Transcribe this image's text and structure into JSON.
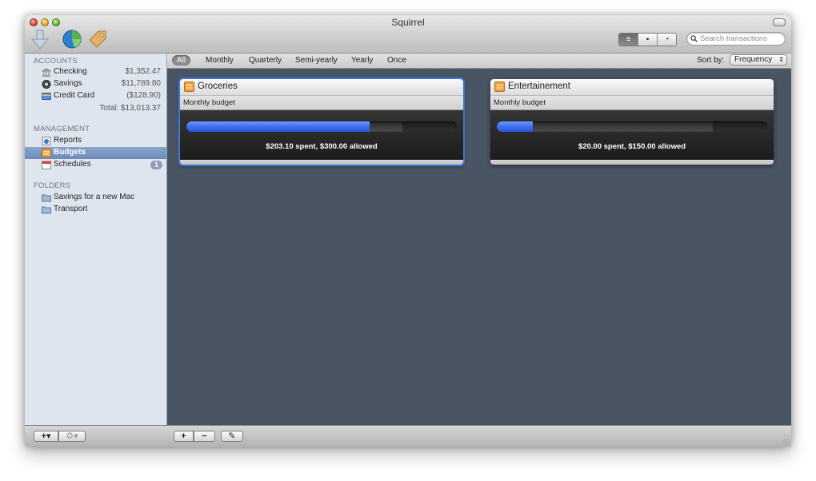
{
  "window": {
    "title": "Squirrel"
  },
  "toolbar": {
    "icons": [
      "download-arrow-icon",
      "globe-chart-icon",
      "tag-icon"
    ],
    "view_modes": [
      {
        "icon": "list-view-icon",
        "glyph": "≡",
        "active": true
      },
      {
        "icon": "column-view-icon",
        "glyph": "▪",
        "active": false
      },
      {
        "icon": "chart-view-icon",
        "glyph": "◔",
        "active": false
      }
    ],
    "search_placeholder": "Search transactions"
  },
  "sidebar": {
    "accounts_header": "ACCOUNTS",
    "accounts": [
      {
        "label": "Checking",
        "amount": "$1,352.47",
        "icon": "bank-icon"
      },
      {
        "label": "Savings",
        "amount": "$11,789.80",
        "icon": "safe-icon"
      },
      {
        "label": "Credit Card",
        "amount": "($128.90)",
        "icon": "credit-card-icon"
      }
    ],
    "total": "Total: $13,013.37",
    "management_header": "MANAGEMENT",
    "management": [
      {
        "label": "Reports",
        "icon": "reports-icon",
        "selected": false
      },
      {
        "label": "Budgets",
        "icon": "budgets-icon",
        "selected": true
      },
      {
        "label": "Schedules",
        "icon": "schedules-icon",
        "selected": false,
        "badge": "1"
      }
    ],
    "folders_header": "FOLDERS",
    "folders": [
      {
        "label": "Savings for a new Mac",
        "icon": "folder-icon"
      },
      {
        "label": "Transport",
        "icon": "folder-icon"
      }
    ]
  },
  "filters": {
    "options": [
      "All",
      "Monthly",
      "Quarterly",
      "Semi-yearly",
      "Yearly",
      "Once"
    ],
    "active": "All",
    "sort_label": "Sort by:",
    "sort_value": "Frequency"
  },
  "budgets": [
    {
      "title": "Groceries",
      "period": "Monthly budget",
      "summary": "$203.10 spent, $300.00 allowed",
      "spent": 203.1,
      "allowed": 300.0,
      "selected": true
    },
    {
      "title": "Entertainement",
      "period": "Monthly budget",
      "summary": "$20.00 spent, $150.00 allowed",
      "spent": 20.0,
      "allowed": 150.0,
      "selected": false
    }
  ],
  "bottombar": {
    "sidebar_add": "+▾",
    "sidebar_gear": "⚙▾",
    "add": "+",
    "remove": "−",
    "edit": "✎"
  },
  "colors": {
    "content_bg": "#4a5563",
    "sidebar_bg": "#dfe5ee",
    "selection": "#6c8bb8",
    "progress_fill": "#3f6df0",
    "card_focus": "#3b78d8"
  }
}
